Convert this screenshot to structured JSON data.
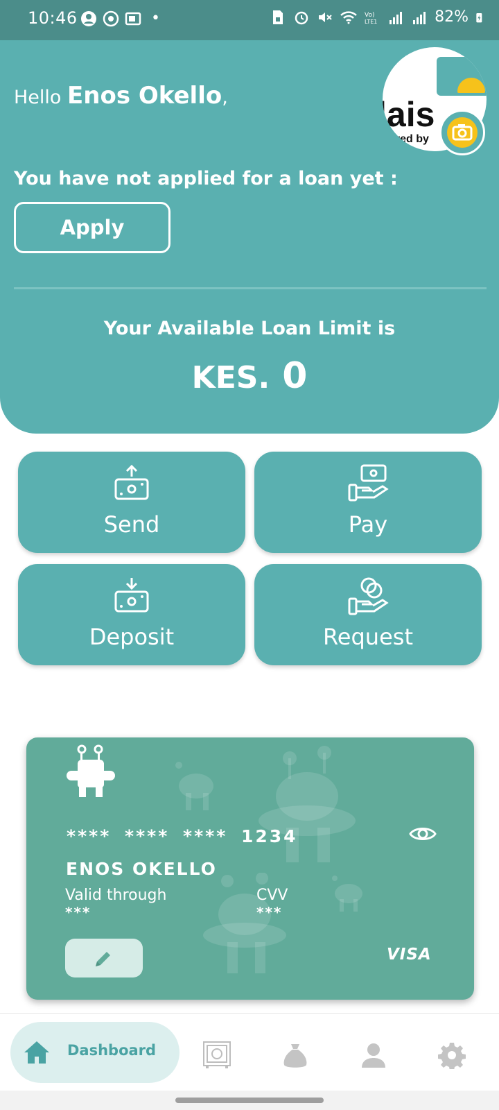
{
  "status_bar": {
    "time": "10:46",
    "dot": "•",
    "battery": "82%",
    "left_icons": [
      "account-icon",
      "sync-icon",
      "vault-icon"
    ],
    "right_icons": [
      "sim-icon",
      "alarm-icon",
      "mute-icon",
      "wifi-icon",
      "volte-icon",
      "signal-icon",
      "signal-icon",
      "battery-charging-icon"
    ]
  },
  "header": {
    "greeting": "Hello",
    "user_name": "Enos Okello",
    "comma": ",",
    "notice": "You have not applied for a loan yet :",
    "apply_label": "Apply",
    "limit_label": "Your Available Loan Limit is",
    "currency": "KES.",
    "limit_amount": "0",
    "avatar_logo_text": "lais",
    "avatar_logo_sub": "ered by"
  },
  "actions": [
    {
      "label": "Send",
      "icon": "send-money-icon"
    },
    {
      "label": "Pay",
      "icon": "pay-icon"
    },
    {
      "label": "Deposit",
      "icon": "deposit-icon"
    },
    {
      "label": "Request",
      "icon": "request-icon"
    }
  ],
  "card": {
    "number": "**** **** **** 1234",
    "holder": "ENOS OKELLO",
    "valid_label": "Valid through",
    "valid_value": "***",
    "cvv_label": "CVV",
    "cvv_value": "***",
    "brand": "VISA"
  },
  "nav": {
    "dashboard_label": "Dashboard",
    "items": [
      "home-icon",
      "safe-icon",
      "money-bag-icon",
      "person-icon",
      "settings-icon"
    ]
  },
  "colors": {
    "primary": "#5ab0b0",
    "status_bar": "#4b8d8a",
    "card": "#61ab9a",
    "accent_yellow": "#f6c21b"
  }
}
